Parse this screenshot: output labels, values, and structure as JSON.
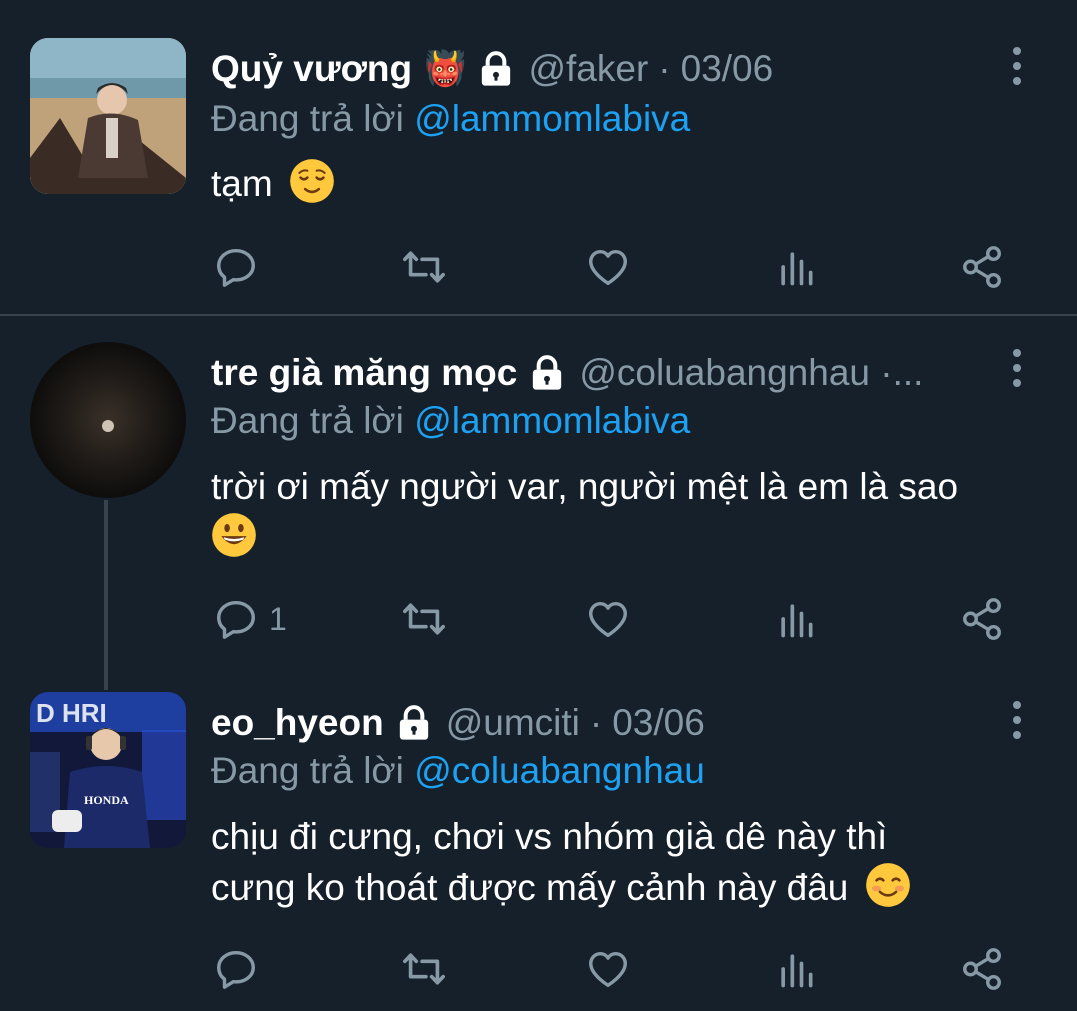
{
  "tweets": [
    {
      "name": "Quỷ vương",
      "badge_emoji": "👹",
      "handle": "@faker",
      "sep": "·",
      "date": "03/06",
      "reply_prefix": "Đang trả lời",
      "reply_to": "@lammomlabiva",
      "text": "tạm",
      "text_emoji": "relieved-face",
      "reply_count": ""
    },
    {
      "name": "tre già măng mọc",
      "badge_emoji": "",
      "handle": "@coluabangnhau ·...",
      "sep": "",
      "date": "",
      "reply_prefix": "Đang trả lời",
      "reply_to": "@lammomlabiva",
      "text": "trời ơi mấy người var, người mệt là em là sao",
      "text_emoji": "grinning-face",
      "reply_count": "1"
    },
    {
      "name": "eo_hyeon",
      "badge_emoji": "",
      "handle": "@umciti",
      "sep": "·",
      "date": "03/06",
      "reply_prefix": "Đang trả lời",
      "reply_to": "@coluabangnhau",
      "text_line1": "chịu đi cưng, chơi vs nhóm già dê này thì",
      "text_line2": "cưng ko thoát được mấy cảnh này đâu",
      "text_emoji": "smiling-face",
      "reply_count": ""
    }
  ],
  "colors": {
    "background": "#15202b",
    "secondary_text": "#8899a6",
    "mention": "#1da1f2",
    "divider": "#38444d"
  },
  "icons": [
    "reply-icon",
    "retweet-icon",
    "like-icon",
    "analytics-icon",
    "share-icon",
    "lock-icon",
    "more-icon"
  ]
}
